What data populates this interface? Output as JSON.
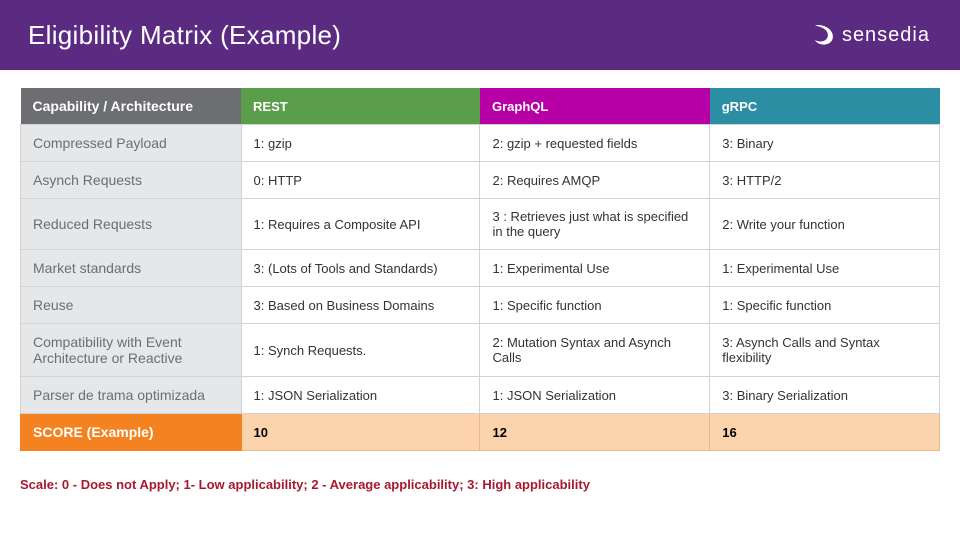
{
  "header": {
    "title": "Eligibility Matrix (Example)",
    "brand": "sensedia"
  },
  "table": {
    "headers": {
      "capability": "Capability / Architecture",
      "rest": "REST",
      "graphql": "GraphQL",
      "grpc": "gRPC"
    },
    "rows": [
      {
        "capability": "Compressed Payload",
        "rest": "1: gzip",
        "graphql": "2: gzip + requested fields",
        "grpc": "3: Binary"
      },
      {
        "capability": "Asynch Requests",
        "rest": "0: HTTP",
        "graphql": "2: Requires AMQP",
        "grpc": "3: HTTP/2"
      },
      {
        "capability": "Reduced Requests",
        "rest": "1: Requires a Composite API",
        "graphql": "3 : Retrieves just what is specified in the query",
        "grpc": "2: Write your function"
      },
      {
        "capability": "Market standards",
        "rest": "3: (Lots of Tools and Standards)",
        "graphql": "1: Experimental Use",
        "grpc": "1: Experimental Use"
      },
      {
        "capability": "Reuse",
        "rest": "3: Based on Business Domains",
        "graphql": "1: Specific function",
        "grpc": "1: Specific function"
      },
      {
        "capability": "Compatibility with Event Architecture or Reactive",
        "rest": "1: Synch Requests.",
        "graphql": "2: Mutation Syntax and Asynch Calls",
        "grpc": "3: Asynch Calls and Syntax flexibility"
      },
      {
        "capability": "Parser de trama optimizada",
        "rest": "1: JSON Serialization",
        "graphql": "1: JSON Serialization",
        "grpc": "3: Binary Serialization"
      }
    ],
    "score": {
      "label": "SCORE (Example)",
      "rest": "10",
      "graphql": "12",
      "grpc": "16"
    }
  },
  "legend": "Scale: 0 - Does not Apply; 1- Low applicability; 2 - Average applicability; 3: High applicability",
  "chart_data": {
    "type": "table",
    "title": "Eligibility Matrix (Example)",
    "columns": [
      "REST",
      "GraphQL",
      "gRPC"
    ],
    "rows": [
      "Compressed Payload",
      "Asynch Requests",
      "Reduced Requests",
      "Market standards",
      "Reuse",
      "Compatibility with Event Architecture or Reactive",
      "Parser de trama optimizada"
    ],
    "values": [
      [
        1,
        2,
        3
      ],
      [
        0,
        2,
        3
      ],
      [
        1,
        3,
        2
      ],
      [
        3,
        1,
        1
      ],
      [
        3,
        1,
        1
      ],
      [
        1,
        2,
        3
      ],
      [
        1,
        1,
        3
      ]
    ],
    "score": {
      "REST": 10,
      "GraphQL": 12,
      "gRPC": 16
    },
    "scale": {
      "0": "Does not Apply",
      "1": "Low applicability",
      "2": "Average applicability",
      "3": "High applicability"
    }
  }
}
